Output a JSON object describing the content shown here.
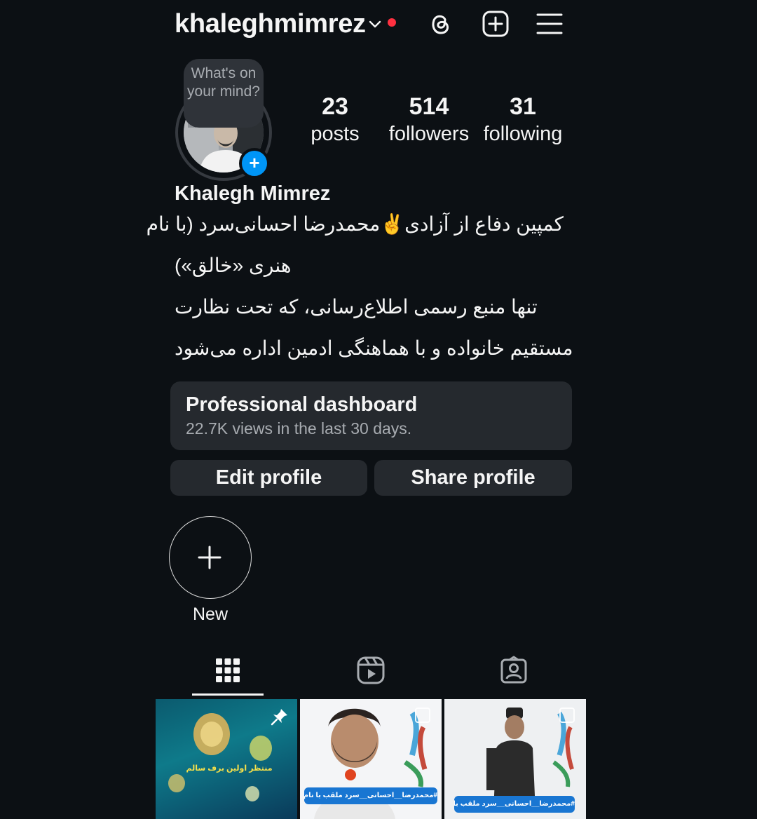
{
  "header": {
    "username": "khaleghmimrez",
    "icons": [
      "chevron-down-icon",
      "notification-dot",
      "threads-icon",
      "add-post-icon",
      "menu-icon"
    ]
  },
  "profile": {
    "note": "What's on your mind?",
    "display_name": "Khalegh Mimrez",
    "stats": [
      {
        "value": "23",
        "label": "posts"
      },
      {
        "value": "514",
        "label": "followers"
      },
      {
        "value": "31",
        "label": "following"
      }
    ],
    "bio_lines": [
      "کمپین دفاع از آزادی✌️محمدرضا احسانی‌سرد (با نام",
      "هنری «خالق»)",
      "تنها منبع رسمی اطلاع‌رسانی، که تحت نظارت",
      "مستقیم خانواده و با هماهنگی ادمین  اداره می‌شود"
    ]
  },
  "dashboard": {
    "title": "Professional dashboard",
    "subtitle": "22.7K views in the last 30 days."
  },
  "buttons": {
    "edit": "Edit profile",
    "share": "Share profile"
  },
  "highlights": {
    "new_label": "New"
  },
  "tabs": [
    "grid-icon",
    "reels-icon",
    "tagged-icon"
  ],
  "grid": [
    {
      "caption": "منتظر اولین برف سالم",
      "pinned": true
    },
    {
      "caption": "#محمدرضا__احسانی__سرد ملقب با نام هنری خالق",
      "pinned": false
    },
    {
      "caption": "#محمدرضا__احسانی__سرد ملقب با نام هنری خالق",
      "pinned": false
    }
  ]
}
